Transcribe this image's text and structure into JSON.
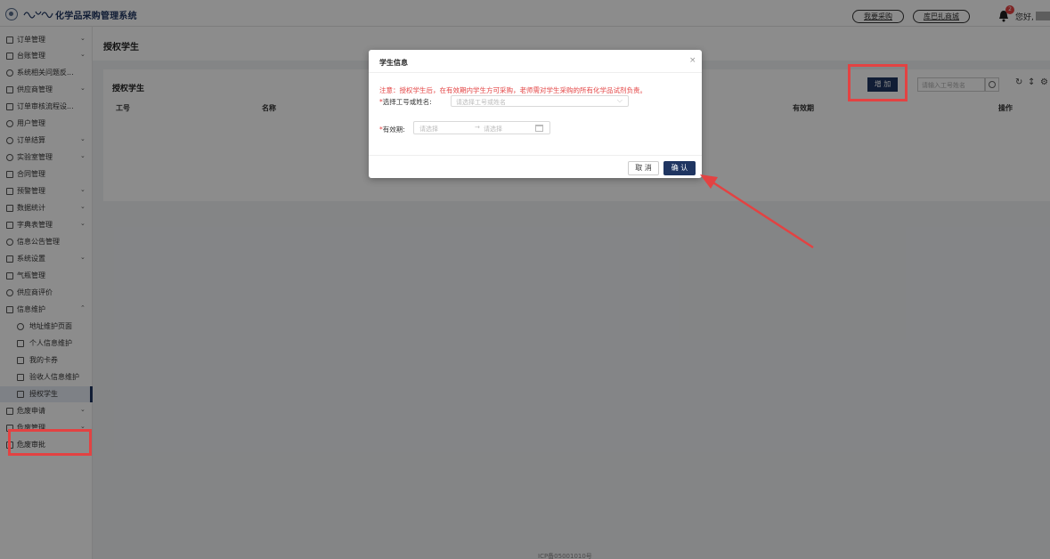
{
  "header": {
    "app_title": "化学品采购管理系统",
    "buy_label": "我要采购",
    "mall_label": "库巴扎商城",
    "notify_count": "2",
    "greeting": "您好,"
  },
  "sidebar": {
    "items": [
      {
        "label": "订单管理",
        "chevron": "⌄"
      },
      {
        "label": "台账管理",
        "chevron": "⌄"
      },
      {
        "label": "系统相关问题反..."
      },
      {
        "label": "供应商管理",
        "chevron": "⌄"
      },
      {
        "label": "订单审核流程设..."
      },
      {
        "label": "用户管理"
      },
      {
        "label": "订单结算",
        "chevron": "⌄"
      },
      {
        "label": "实验室管理",
        "chevron": "⌄"
      },
      {
        "label": "合同管理"
      },
      {
        "label": "预警管理",
        "chevron": "⌄"
      },
      {
        "label": "数据统计",
        "chevron": "⌄"
      },
      {
        "label": "字典表管理",
        "chevron": "⌄"
      },
      {
        "label": "信息公告管理"
      },
      {
        "label": "系统设置",
        "chevron": "⌄"
      },
      {
        "label": "气瓶管理"
      },
      {
        "label": "供应商评价"
      },
      {
        "label": "信息维护",
        "chevron": "⌃"
      },
      {
        "label": "地址维护页面"
      },
      {
        "label": "个人信息维护"
      },
      {
        "label": "我的卡券"
      },
      {
        "label": "验收人信息维护"
      },
      {
        "label": "授权学生"
      },
      {
        "label": "危废申请",
        "chevron": "⌄"
      },
      {
        "label": "危废管理",
        "chevron": "⌄"
      },
      {
        "label": "危废审批"
      }
    ]
  },
  "main": {
    "page_title": "授权学生",
    "card_title": "授权学生",
    "add_label": "增 加",
    "search_placeholder": "请输入工号姓名",
    "columns": [
      "工号",
      "名称",
      "有效期",
      "操作"
    ],
    "footer": "ICP备05001010号"
  },
  "modal": {
    "title": "学生信息",
    "close": "×",
    "notice": "注意：授权学生后，在有效期内学生方可采购，老师需对学生采购的所有化学品试剂负责。",
    "select_label": "选择工号或姓名:",
    "select_placeholder": "请选择工号或姓名",
    "period_label": "有效期:",
    "start_placeholder": "请选择",
    "end_placeholder": "请选择",
    "range_sep": "→",
    "cancel_label": "取 消",
    "ok_label": "确 认"
  },
  "colors": {
    "brand": "#1f3561",
    "highlight": "#e34242",
    "notice": "#e34242"
  }
}
